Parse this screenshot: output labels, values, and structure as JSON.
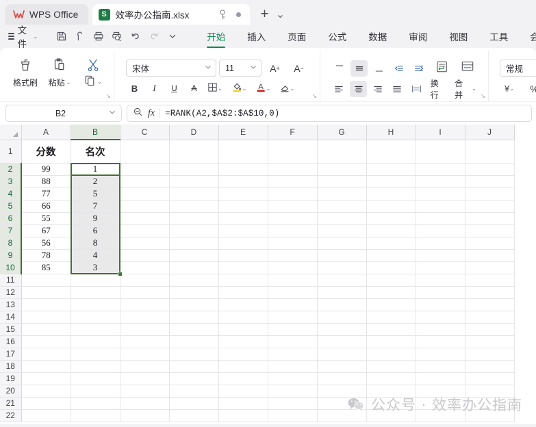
{
  "titlebar": {
    "app_label": "WPS Office",
    "doc_tab": {
      "icon_letter": "S",
      "name": "效率办公指南.xlsx"
    },
    "new_tab_label": "+",
    "tab_list_caret": "⌄"
  },
  "menu": {
    "file_label": "文件",
    "file_caret": "⌄",
    "quick_access": [
      {
        "name": "save-icon",
        "label": "保存"
      },
      {
        "name": "cloud-sync-icon",
        "label": "同步"
      },
      {
        "name": "print-icon",
        "label": "打印"
      },
      {
        "name": "print-preview-icon",
        "label": "打印预览"
      },
      {
        "name": "undo-icon",
        "label": "撤销"
      },
      {
        "name": "redo-icon",
        "label": "恢复"
      },
      {
        "name": "chevron-down-icon",
        "label": "更多"
      }
    ],
    "tabs": [
      {
        "label": "开始",
        "active": true
      },
      {
        "label": "插入",
        "active": false
      },
      {
        "label": "页面",
        "active": false
      },
      {
        "label": "公式",
        "active": false
      },
      {
        "label": "数据",
        "active": false
      },
      {
        "label": "审阅",
        "active": false
      },
      {
        "label": "视图",
        "active": false
      },
      {
        "label": "工具",
        "active": false
      },
      {
        "label": "会员专享",
        "active": false
      }
    ]
  },
  "ribbon": {
    "clipboard": {
      "format_painter": "格式刷",
      "paste": "粘贴",
      "paste_caret": "⌄",
      "cut_name": "剪切",
      "copy_caret": "⌄",
      "launcher": "↘"
    },
    "font": {
      "font_name": "宋体",
      "font_size": "11",
      "grow_label": "A",
      "grow_sup": "+",
      "shrink_label": "A",
      "shrink_sup": "−",
      "bold": "B",
      "italic": "I",
      "underline": "U",
      "strikethrough": "A",
      "borders_caret": "⌄",
      "fill_caret": "⌄",
      "fontcolor_label": "A",
      "fontcolor_caret": "⌄",
      "clear_caret": "⌄",
      "launcher": "↘"
    },
    "align": {
      "wrap_text": "换行",
      "merge": "合并",
      "merge_caret": "⌄",
      "launcher": "↘"
    },
    "number": {
      "format": "常规",
      "currency_label": "¥",
      "currency_caret": "⌄",
      "percent_label": "%",
      "launcher": "↘"
    }
  },
  "formula_bar": {
    "name_box_value": "B2",
    "name_box_caret": "⌄",
    "fx_label": "fx",
    "formula": "=RANK(A2,$A$2:$A$10,0)"
  },
  "grid": {
    "columns": [
      "A",
      "B",
      "C",
      "D",
      "E",
      "F",
      "G",
      "H",
      "I",
      "J"
    ],
    "selected_column": "B",
    "rows": [
      "1",
      "2",
      "3",
      "4",
      "5",
      "6",
      "7",
      "8",
      "9",
      "10",
      "11",
      "12",
      "13",
      "14",
      "15",
      "16",
      "17",
      "18",
      "19",
      "20",
      "21",
      "22"
    ],
    "selected_rows": [
      "2",
      "3",
      "4",
      "5",
      "6",
      "7",
      "8",
      "9",
      "10"
    ],
    "cells": {
      "1": {
        "A": "分数",
        "B": "名次"
      },
      "2": {
        "A": "99",
        "B": "1"
      },
      "3": {
        "A": "88",
        "B": "2"
      },
      "4": {
        "A": "77",
        "B": "5"
      },
      "5": {
        "A": "66",
        "B": "7"
      },
      "6": {
        "A": "55",
        "B": "9"
      },
      "7": {
        "A": "67",
        "B": "6"
      },
      "8": {
        "A": "56",
        "B": "8"
      },
      "9": {
        "A": "78",
        "B": "4"
      },
      "10": {
        "A": "85",
        "B": "3"
      }
    },
    "selection_range": "B2:B10",
    "active_cell": "B2"
  },
  "watermark": {
    "text": "公众号 · 效率办公指南"
  },
  "colors": {
    "accent_green": "#0f8a52",
    "selection_green": "#3f7230",
    "excel_icon_green": "#1e7d45",
    "wps_red": "#d94b3f",
    "shade_gray": "#e9e9e9"
  }
}
